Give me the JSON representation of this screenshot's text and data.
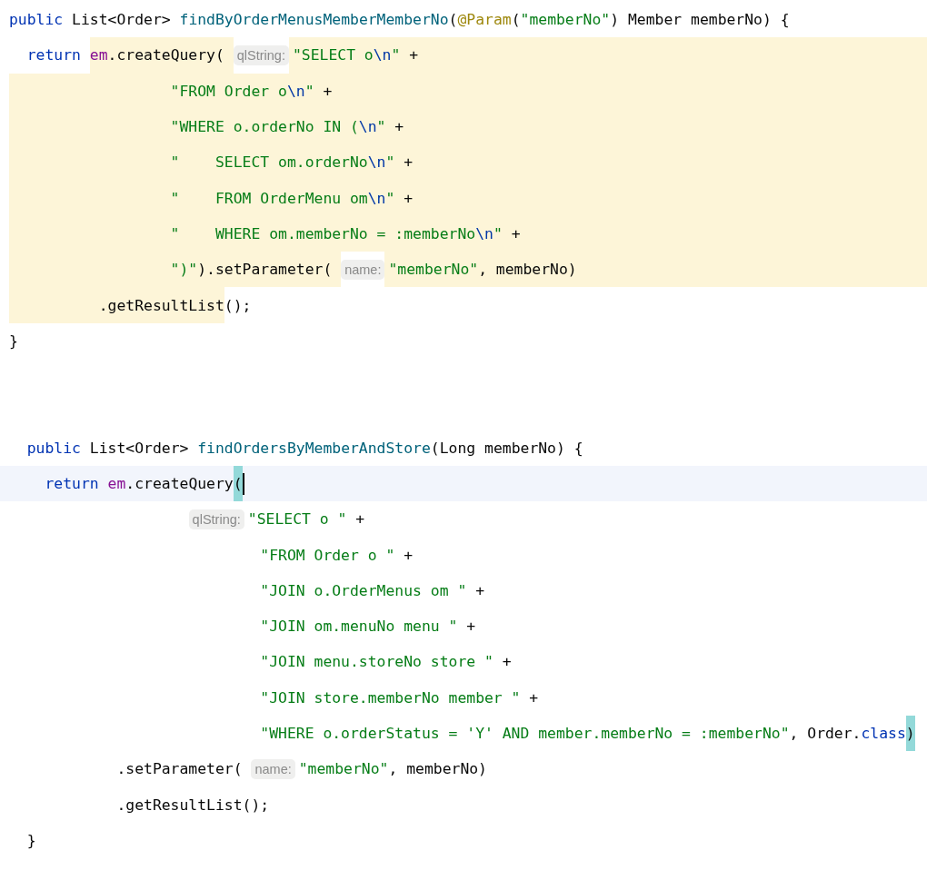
{
  "lines": [
    {
      "kind": "code",
      "fill": false,
      "parts": [
        {
          "kind": "code",
          "highlighted": false,
          "segments": [
            {
              "kind": "kw",
              "text": "public"
            },
            {
              "kind": "plain",
              "text": " List<Order> "
            },
            {
              "kind": "decl",
              "text": "findByOrderMenusMemberMemberNo"
            },
            {
              "kind": "plain",
              "text": "("
            },
            {
              "kind": "ann",
              "text": "@Param"
            },
            {
              "kind": "plain",
              "text": "("
            },
            {
              "kind": "str",
              "text": "\"memberNo\""
            },
            {
              "kind": "plain",
              "text": ") Member memberNo) {"
            }
          ]
        }
      ]
    },
    {
      "kind": "code",
      "fill": true,
      "parts": [
        {
          "kind": "code",
          "highlighted": false,
          "segments": [
            {
              "kind": "kw",
              "text": "  return "
            }
          ]
        },
        {
          "kind": "code",
          "highlighted": true,
          "segments": [
            {
              "kind": "field",
              "text": "em"
            },
            {
              "kind": "plain",
              "text": ".createQuery( "
            }
          ]
        },
        {
          "kind": "hint",
          "text": "qlString:"
        },
        {
          "kind": "code",
          "highlighted": true,
          "segments": [
            {
              "kind": "str",
              "text": "\"SELECT o"
            },
            {
              "kind": "esc",
              "text": "\\n"
            },
            {
              "kind": "str",
              "text": "\""
            },
            {
              "kind": "plain",
              "text": " +"
            }
          ]
        }
      ]
    },
    {
      "kind": "code",
      "fill": true,
      "parts": [
        {
          "kind": "code",
          "highlighted": true,
          "segments": [
            {
              "kind": "str",
              "text": "                  \"FROM Order o"
            },
            {
              "kind": "esc",
              "text": "\\n"
            },
            {
              "kind": "str",
              "text": "\""
            },
            {
              "kind": "plain",
              "text": " +"
            }
          ]
        }
      ]
    },
    {
      "kind": "code",
      "fill": true,
      "parts": [
        {
          "kind": "code",
          "highlighted": true,
          "segments": [
            {
              "kind": "str",
              "text": "                  \"WHERE o.orderNo IN ("
            },
            {
              "kind": "esc",
              "text": "\\n"
            },
            {
              "kind": "str",
              "text": "\""
            },
            {
              "kind": "plain",
              "text": " +"
            }
          ]
        }
      ]
    },
    {
      "kind": "code",
      "fill": true,
      "parts": [
        {
          "kind": "code",
          "highlighted": true,
          "segments": [
            {
              "kind": "str",
              "text": "                  \"    SELECT om.orderNo"
            },
            {
              "kind": "esc",
              "text": "\\n"
            },
            {
              "kind": "str",
              "text": "\""
            },
            {
              "kind": "plain",
              "text": " +"
            }
          ]
        }
      ]
    },
    {
      "kind": "code",
      "fill": true,
      "parts": [
        {
          "kind": "code",
          "highlighted": true,
          "segments": [
            {
              "kind": "str",
              "text": "                  \"    FROM OrderMenu om"
            },
            {
              "kind": "esc",
              "text": "\\n"
            },
            {
              "kind": "str",
              "text": "\""
            },
            {
              "kind": "plain",
              "text": " +"
            }
          ]
        }
      ]
    },
    {
      "kind": "code",
      "fill": true,
      "parts": [
        {
          "kind": "code",
          "highlighted": true,
          "segments": [
            {
              "kind": "str",
              "text": "                  \"    WHERE om.memberNo = :memberNo"
            },
            {
              "kind": "esc",
              "text": "\\n"
            },
            {
              "kind": "str",
              "text": "\""
            },
            {
              "kind": "plain",
              "text": " +"
            }
          ]
        }
      ]
    },
    {
      "kind": "code",
      "fill": true,
      "parts": [
        {
          "kind": "code",
          "highlighted": true,
          "segments": [
            {
              "kind": "str",
              "text": "                  \")\""
            },
            {
              "kind": "plain",
              "text": ").setParameter( "
            }
          ]
        },
        {
          "kind": "hint",
          "text": "name:"
        },
        {
          "kind": "code",
          "highlighted": true,
          "segments": [
            {
              "kind": "str",
              "text": "\"memberNo\""
            },
            {
              "kind": "plain",
              "text": ", memberNo)"
            }
          ]
        }
      ]
    },
    {
      "kind": "code",
      "fill": false,
      "parts": [
        {
          "kind": "code",
          "highlighted": true,
          "segments": [
            {
              "kind": "plain",
              "text": "          .getResultList"
            }
          ]
        },
        {
          "kind": "code",
          "highlighted": false,
          "segments": [
            {
              "kind": "plain",
              "text": "();"
            }
          ]
        }
      ]
    },
    {
      "kind": "code",
      "fill": false,
      "parts": [
        {
          "kind": "code",
          "highlighted": false,
          "segments": [
            {
              "kind": "plain",
              "text": "}"
            }
          ]
        }
      ]
    },
    {
      "kind": "blank"
    },
    {
      "kind": "blank"
    },
    {
      "kind": "code",
      "fill": false,
      "parts": [
        {
          "kind": "code",
          "highlighted": false,
          "segments": [
            {
              "kind": "kw",
              "text": "  public"
            },
            {
              "kind": "plain",
              "text": " List<Order> "
            },
            {
              "kind": "decl",
              "text": "findOrdersByMemberAndStore"
            },
            {
              "kind": "plain",
              "text": "(Long memberNo) {"
            }
          ]
        }
      ]
    },
    {
      "kind": "current",
      "fill": false,
      "parts": [
        {
          "kind": "code",
          "highlighted": false,
          "segments": [
            {
              "kind": "kw",
              "text": "    return "
            },
            {
              "kind": "field",
              "text": "em"
            },
            {
              "kind": "plain",
              "text": ".createQuery"
            },
            {
              "kind": "brace",
              "text": "("
            }
          ]
        },
        {
          "kind": "caret"
        }
      ]
    },
    {
      "kind": "hint_line",
      "fill": false,
      "parts": [
        {
          "kind": "hint",
          "text": "qlString:"
        },
        {
          "kind": "code",
          "highlighted": false,
          "segments": [
            {
              "kind": "str",
              "text": "\"SELECT o \""
            },
            {
              "kind": "plain",
              "text": " +"
            }
          ]
        }
      ]
    },
    {
      "kind": "code",
      "fill": false,
      "parts": [
        {
          "kind": "code",
          "highlighted": false,
          "segments": [
            {
              "kind": "str",
              "text": "                            \"FROM Order o \""
            },
            {
              "kind": "plain",
              "text": " +"
            }
          ]
        }
      ]
    },
    {
      "kind": "code",
      "fill": false,
      "parts": [
        {
          "kind": "code",
          "highlighted": false,
          "segments": [
            {
              "kind": "str",
              "text": "                            \"JOIN o.OrderMenus om \""
            },
            {
              "kind": "plain",
              "text": " +"
            }
          ]
        }
      ]
    },
    {
      "kind": "code",
      "fill": false,
      "parts": [
        {
          "kind": "code",
          "highlighted": false,
          "segments": [
            {
              "kind": "str",
              "text": "                            \"JOIN om.menuNo menu \""
            },
            {
              "kind": "plain",
              "text": " +"
            }
          ]
        }
      ]
    },
    {
      "kind": "code",
      "fill": false,
      "parts": [
        {
          "kind": "code",
          "highlighted": false,
          "segments": [
            {
              "kind": "str",
              "text": "                            \"JOIN menu.storeNo store \""
            },
            {
              "kind": "plain",
              "text": " +"
            }
          ]
        }
      ]
    },
    {
      "kind": "code",
      "fill": false,
      "parts": [
        {
          "kind": "code",
          "highlighted": false,
          "segments": [
            {
              "kind": "str",
              "text": "                            \"JOIN store.memberNo member \""
            },
            {
              "kind": "plain",
              "text": " +"
            }
          ]
        }
      ]
    },
    {
      "kind": "code",
      "fill": false,
      "parts": [
        {
          "kind": "code",
          "highlighted": false,
          "segments": [
            {
              "kind": "str",
              "text": "                            \"WHERE o.orderStatus = 'Y' AND member.memberNo = :memberNo\""
            },
            {
              "kind": "plain",
              "text": ", Order."
            },
            {
              "kind": "kw",
              "text": "class"
            },
            {
              "kind": "brace",
              "text": ")"
            }
          ]
        }
      ]
    },
    {
      "kind": "code",
      "fill": false,
      "parts": [
        {
          "kind": "code",
          "highlighted": false,
          "segments": [
            {
              "kind": "plain",
              "text": "            .setParameter( "
            }
          ]
        },
        {
          "kind": "hint",
          "text": "name:"
        },
        {
          "kind": "code",
          "highlighted": false,
          "segments": [
            {
              "kind": "str",
              "text": "\"memberNo\""
            },
            {
              "kind": "plain",
              "text": ", memberNo)"
            }
          ]
        }
      ]
    },
    {
      "kind": "code",
      "fill": false,
      "parts": [
        {
          "kind": "code",
          "highlighted": false,
          "segments": [
            {
              "kind": "plain",
              "text": "            .getResultList();"
            }
          ]
        }
      ]
    },
    {
      "kind": "code",
      "fill": false,
      "parts": [
        {
          "kind": "code",
          "highlighted": false,
          "segments": [
            {
              "kind": "plain",
              "text": "  }"
            }
          ]
        }
      ]
    }
  ]
}
